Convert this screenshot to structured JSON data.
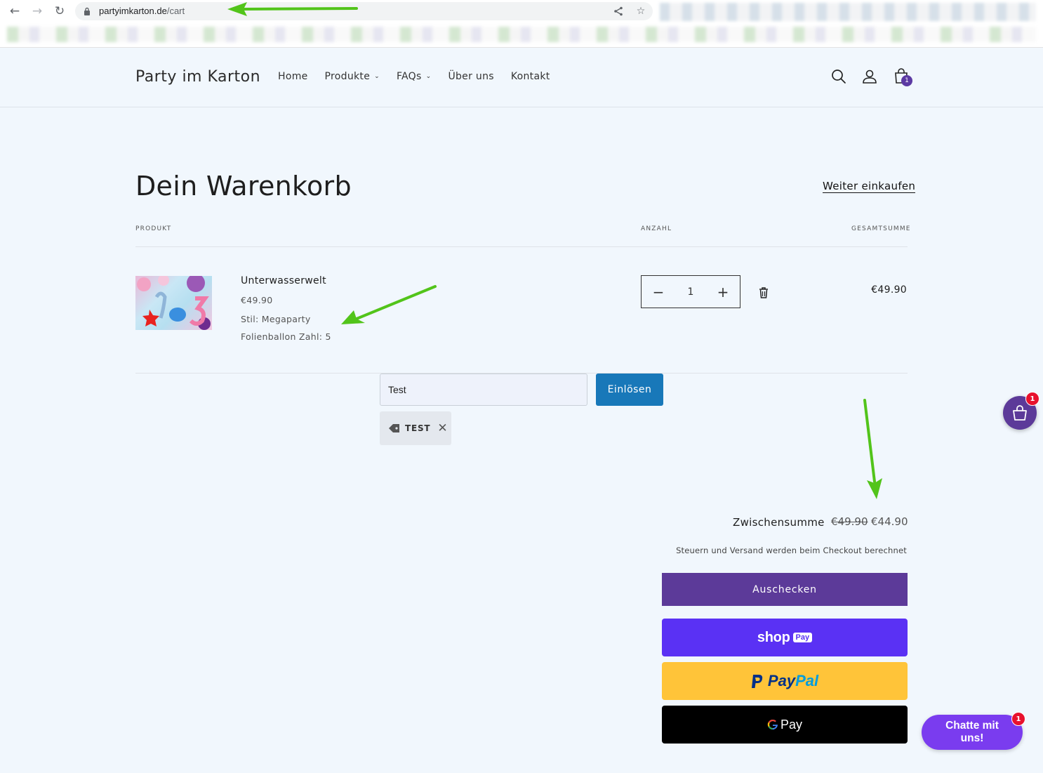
{
  "browser": {
    "url_host": "partyimkarton.de",
    "url_path": "/cart"
  },
  "header": {
    "logo": "Party im Karton",
    "menu": [
      {
        "label": "Home"
      },
      {
        "label": "Produkte"
      },
      {
        "label": "FAQs"
      },
      {
        "label": "Über uns"
      },
      {
        "label": "Kontakt"
      }
    ],
    "cart_count": "1"
  },
  "cart": {
    "title": "Dein Warenkorb",
    "continue_link": "Weiter einkaufen",
    "col_product": "PRODUKT",
    "col_quantity": "ANZAHL",
    "col_total": "GESAMTSUMME",
    "item": {
      "name": "Unterwasserwelt",
      "price": "€49.90",
      "option_style": "Stil: Megaparty",
      "option_number": "Folienballon Zahl: 5",
      "quantity": "1",
      "line_total": "€49.90"
    },
    "coupon": {
      "value": "Test",
      "redeem_label": "Einlösen",
      "applied_code": "TEST"
    },
    "summary": {
      "subtotal_label": "Zwischensumme",
      "old_price": "€49.90",
      "new_price": "€44.90",
      "tax_note": "Steuern und Versand werden beim Checkout berechnet",
      "checkout_label": "Auschecken"
    },
    "express": {
      "shoppay_text": "shop",
      "shoppay_chip": "Pay",
      "paypal_pay": "Pay",
      "paypal_pal": "Pal",
      "gpay_text": "Pay"
    }
  },
  "widgets": {
    "float_cart_badge": "1",
    "chat_label": "Chatte mit uns!",
    "chat_badge": "1"
  },
  "colors": {
    "accent_purple": "#5c3a99",
    "redeem_blue": "#1878b9",
    "annotation_green": "#52c41a"
  }
}
